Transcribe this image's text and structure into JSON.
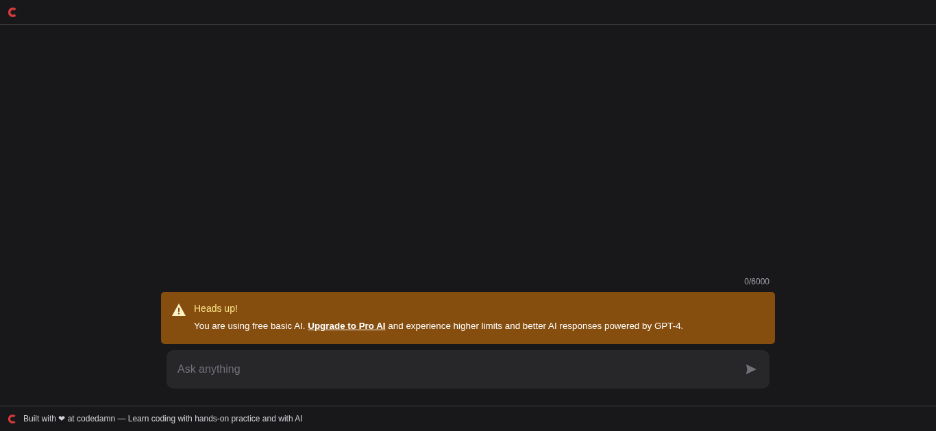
{
  "counter": "0/6000",
  "alert": {
    "title": "Heads up!",
    "text_before": "You are using free basic AI. ",
    "link": "Upgrade to Pro AI",
    "text_after": " and experience higher limits and better AI responses powered by GPT-4."
  },
  "input": {
    "placeholder": "Ask anything"
  },
  "send": {
    "disabled": true
  },
  "footer": {
    "text": "Built with ❤ at codedamn — Learn coding with hands-on practice and with AI"
  }
}
